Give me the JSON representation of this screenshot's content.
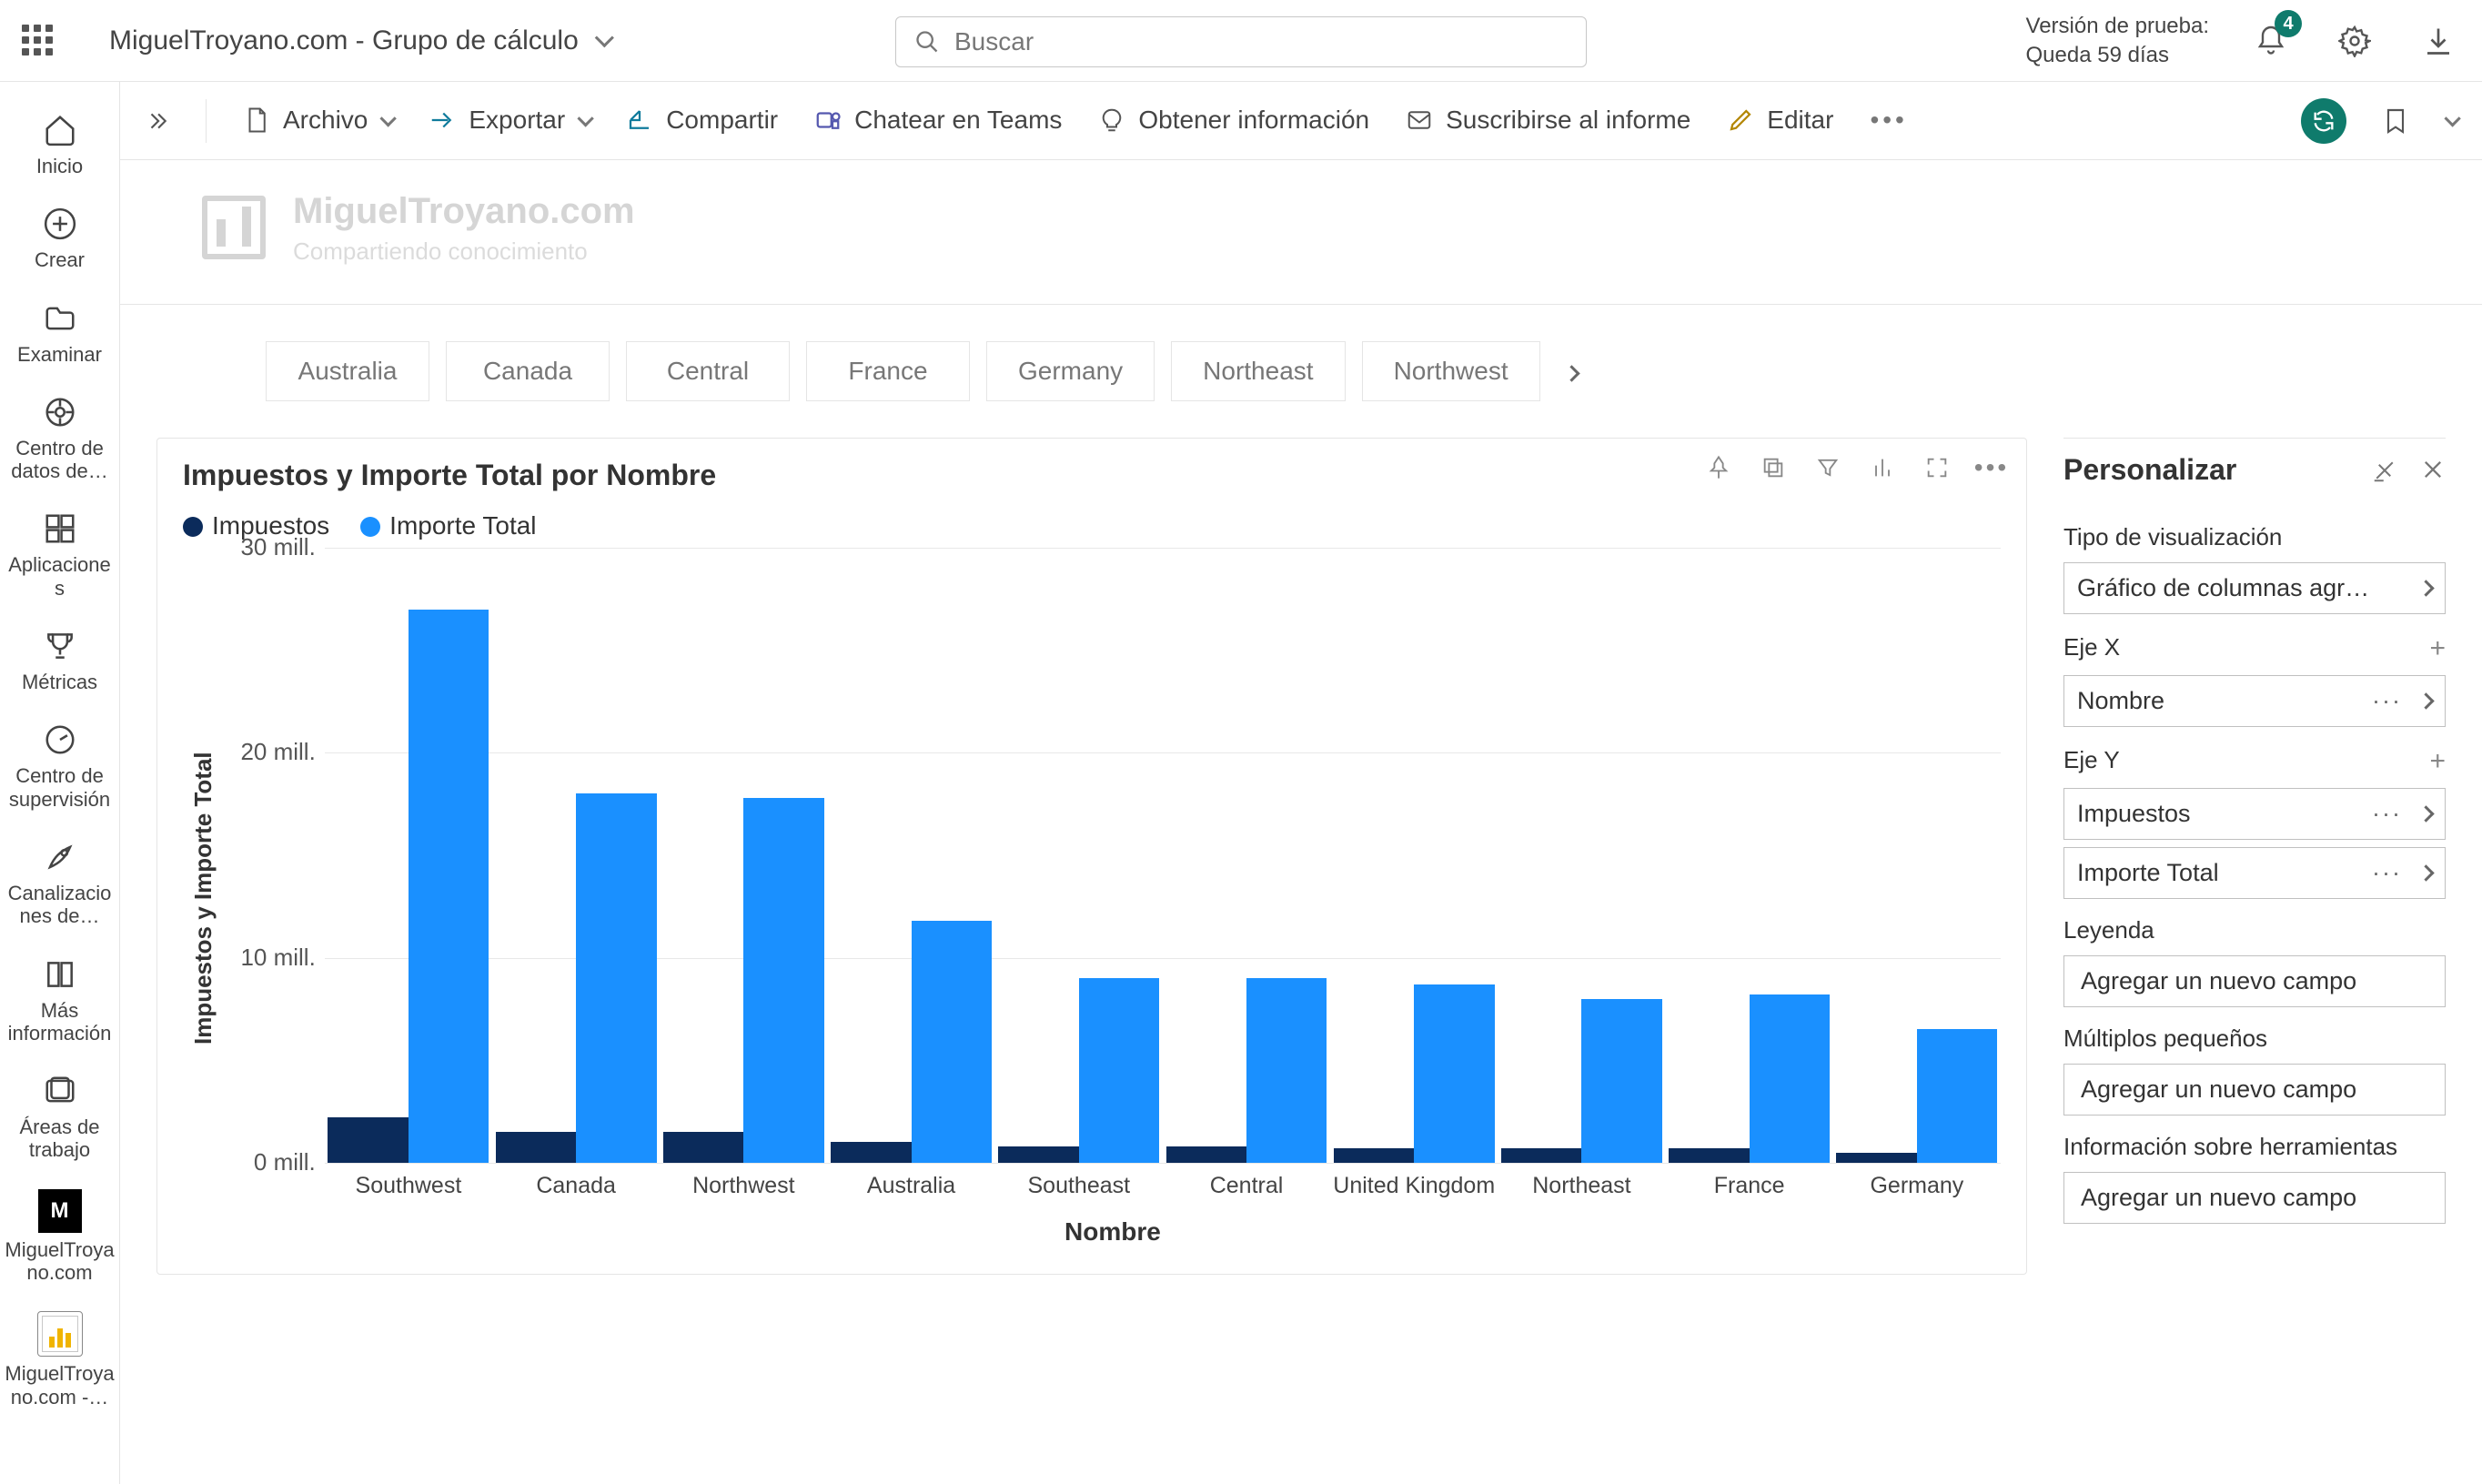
{
  "topbar": {
    "breadcrumb": "MiguelTroyano.com - Grupo de cálculo",
    "search_placeholder": "Buscar",
    "trial_line1": "Versión de prueba:",
    "trial_line2": "Queda 59 días",
    "badge": "4"
  },
  "sidebar": {
    "items": [
      {
        "label": "Inicio"
      },
      {
        "label": "Crear"
      },
      {
        "label": "Examinar"
      },
      {
        "label": "Centro de datos de…"
      },
      {
        "label": "Aplicaciones"
      },
      {
        "label": "Métricas"
      },
      {
        "label": "Centro de supervisión"
      },
      {
        "label": "Canalizaciones de…"
      },
      {
        "label": "Más información"
      },
      {
        "label": "Áreas de trabajo"
      },
      {
        "label": "MiguelTroyano.com"
      },
      {
        "label": "MiguelTroyano.com -…"
      }
    ]
  },
  "ribbon": {
    "file": "Archivo",
    "export": "Exportar",
    "share": "Compartir",
    "teams": "Chatear en Teams",
    "insights": "Obtener información",
    "subscribe": "Suscribirse al informe",
    "edit": "Editar"
  },
  "brand": {
    "title": "MiguelTroyano.com",
    "subtitle": "Compartiendo conocimiento"
  },
  "slicers": [
    "Australia",
    "Canada",
    "Central",
    "France",
    "Germany",
    "Northeast",
    "Northwest"
  ],
  "chart": {
    "title": "Impuestos y Importe Total por Nombre",
    "legend1": "Impuestos",
    "legend2": "Importe Total",
    "ylabel": "Impuestos y Importe Total",
    "xlabel": "Nombre",
    "yticks": [
      "0 mill.",
      "10 mill.",
      "20 mill.",
      "30 mill."
    ]
  },
  "pane": {
    "title": "Personalizar",
    "vistype_label": "Tipo de visualización",
    "vistype_value": "Gráfico de columnas agr…",
    "xaxis_label": "Eje X",
    "xaxis_value": "Nombre",
    "yaxis_label": "Eje Y",
    "y1": "Impuestos",
    "y2": "Importe Total",
    "legend_label": "Leyenda",
    "legend_add": "Agregar un nuevo campo",
    "small_label": "Múltiplos pequeños",
    "small_add": "Agregar un nuevo campo",
    "tooltip_label": "Información sobre herramientas",
    "tooltip_add": "Agregar un nuevo campo"
  },
  "chart_data": {
    "type": "bar",
    "title": "Impuestos y Importe Total por Nombre",
    "xlabel": "Nombre",
    "ylabel": "Impuestos y Importe Total",
    "ylim": [
      0,
      30
    ],
    "yunit": "mill.",
    "categories": [
      "Southwest",
      "Canada",
      "Northwest",
      "Australia",
      "Southeast",
      "Central",
      "United Kingdom",
      "Northeast",
      "France",
      "Germany"
    ],
    "series": [
      {
        "name": "Impuestos",
        "color": "#0b2b5b",
        "values": [
          2.2,
          1.5,
          1.5,
          1.0,
          0.8,
          0.8,
          0.7,
          0.7,
          0.7,
          0.5
        ]
      },
      {
        "name": "Importe Total",
        "color": "#1a90ff",
        "values": [
          27,
          18,
          17.8,
          11.8,
          9.0,
          9.0,
          8.7,
          8.0,
          8.2,
          6.5
        ]
      }
    ]
  }
}
